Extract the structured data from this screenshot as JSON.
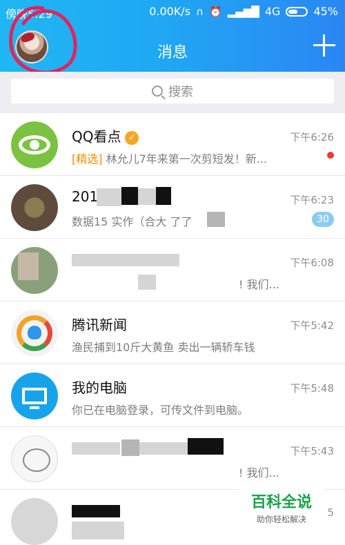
{
  "status": {
    "carrier": "傍晚5:29",
    "speed": "0.00K/s",
    "network": "4G",
    "battery": "45%"
  },
  "header": {
    "title": "消息"
  },
  "search": {
    "placeholder": "搜索"
  },
  "chats": [
    {
      "name": "QQ看点",
      "tag": "[精选]",
      "msg": "林允儿7年来第一次剪短发！新...",
      "time": "下午6:26"
    },
    {
      "name": "2015",
      "msg": "数据15 实作（合大 了了",
      "time": "下午6:23",
      "badge": "30"
    },
    {
      "name": "",
      "msg": "!   我们...",
      "time": "下午6:08"
    },
    {
      "name": "腾讯新闻",
      "msg": "渔民捕到10斤大黄鱼 卖出一辆轿车钱",
      "time": "下午5:42"
    },
    {
      "name": "我的电脑",
      "msg": "你已在电脑登录，可传文件到电脑。",
      "time": "下午5:48"
    },
    {
      "name": "",
      "msg": "!   我们...",
      "time": "下午5:43"
    },
    {
      "name": "",
      "msg": "",
      "time": "5"
    }
  ],
  "watermark": {
    "title": "百科全说",
    "sub": "助你轻松解决"
  }
}
